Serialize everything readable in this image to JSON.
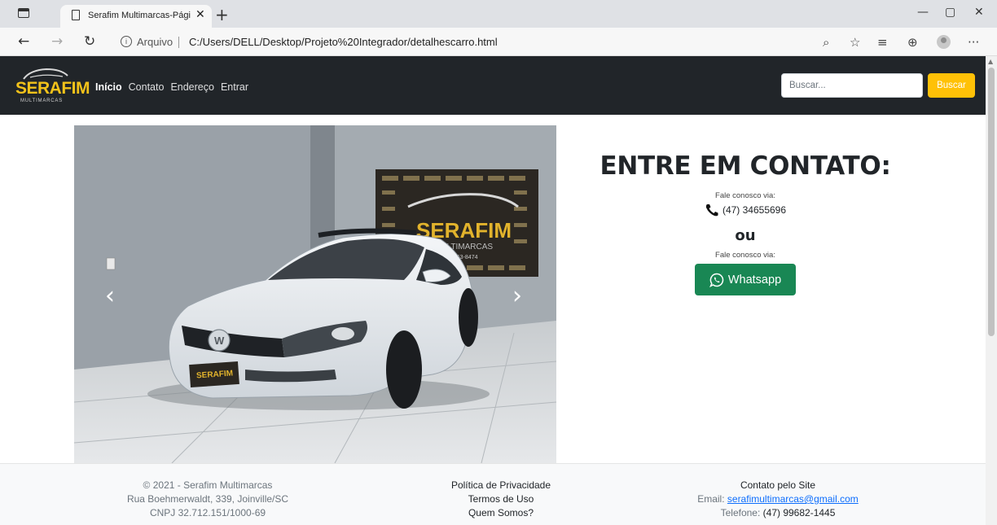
{
  "browser": {
    "tab_title": "Serafim Multimarcas-Página Inicial",
    "tab_close": "✕",
    "new_tab": "+",
    "address_label": "Arquivo",
    "address_url": "C:/Users/DELL/Desktop/Projeto%20Integrador/detalhescarro.html",
    "controls": {
      "minimize": "—",
      "restore": "▢",
      "close": "✕"
    }
  },
  "navbar": {
    "logo_text": "SERAFIM",
    "logo_sub": "MULTIMARCAS",
    "links": [
      "Início",
      "Contato",
      "Endereço",
      "Entrar"
    ],
    "search_placeholder": "Buscar...",
    "search_button": "Buscar"
  },
  "carousel": {
    "prev": "‹",
    "next": "›"
  },
  "contact": {
    "heading": "ENTRE EM CONTATO:",
    "via_label": "Fale conosco via:",
    "phone": "(47) 34655696",
    "or": "ou",
    "via_label_2": "Fale conosco via:",
    "whatsapp_label": "Whatsapp"
  },
  "footer": {
    "col1": [
      "© 2021 - Serafim Multimarcas",
      "Rua Boehmerwaldt, 339, Joinville/SC",
      "CNPJ 32.712.151/1000-69"
    ],
    "col2": [
      "Política de Privacidade",
      "Termos de Uso",
      "Quem Somos?"
    ],
    "col3_title": "Contato pelo Site",
    "email_label": "Email:",
    "email": "serafimultimarcas@gmail.com",
    "phone_label": "Telefone:",
    "phone": "(47) 99682-1445"
  },
  "colors": {
    "navbar_bg": "#212529",
    "accent_yellow": "#ffc107",
    "whatsapp_green": "#198754",
    "link_blue": "#0d6efd"
  }
}
